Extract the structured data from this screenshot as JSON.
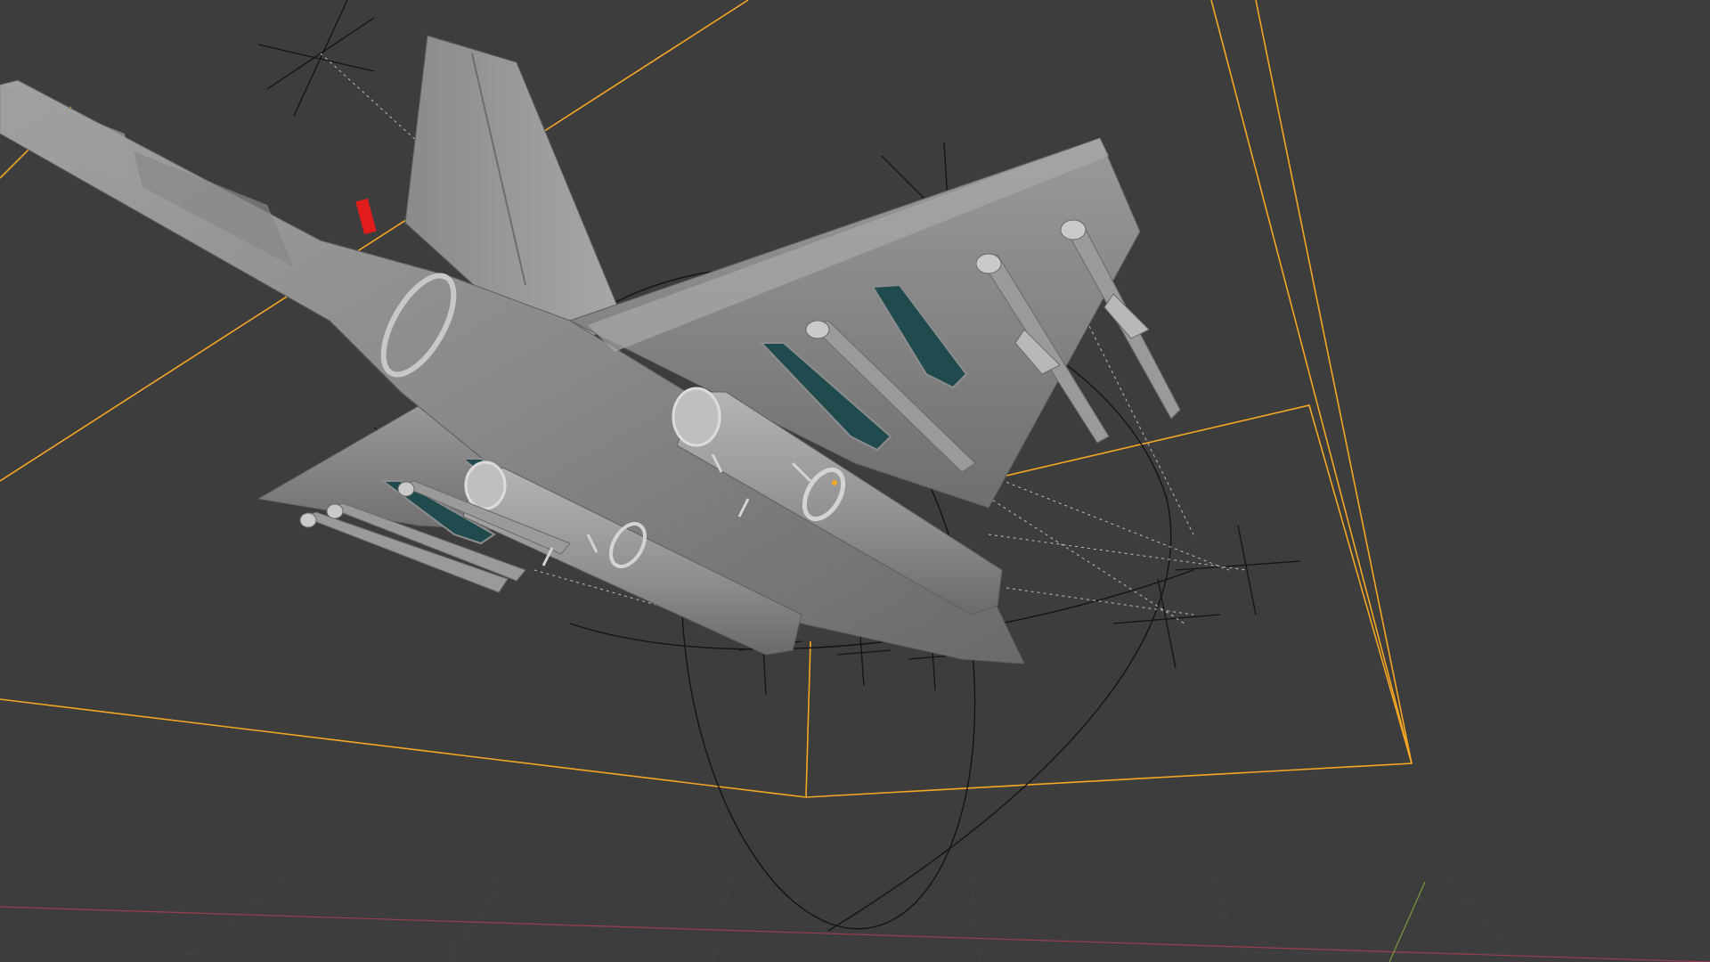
{
  "viewport": {
    "background": "#3d3d3d",
    "selection_outline_color": "#f5a623",
    "wire_color": "#111111",
    "aircraft_body_color": "#8e8e8e",
    "intake_color": "#1f4a4e",
    "nav_light_color": "#e21b1b",
    "grid_color": "#4a4a4a",
    "axis_x_color": "#9a3e4d",
    "axis_y_color": "#7a9a40"
  },
  "objects": [
    {
      "name": "aircraft-mesh",
      "selected": false
    },
    {
      "name": "camera-frame",
      "selected": true
    },
    {
      "name": "light-empties",
      "selected": false
    }
  ]
}
